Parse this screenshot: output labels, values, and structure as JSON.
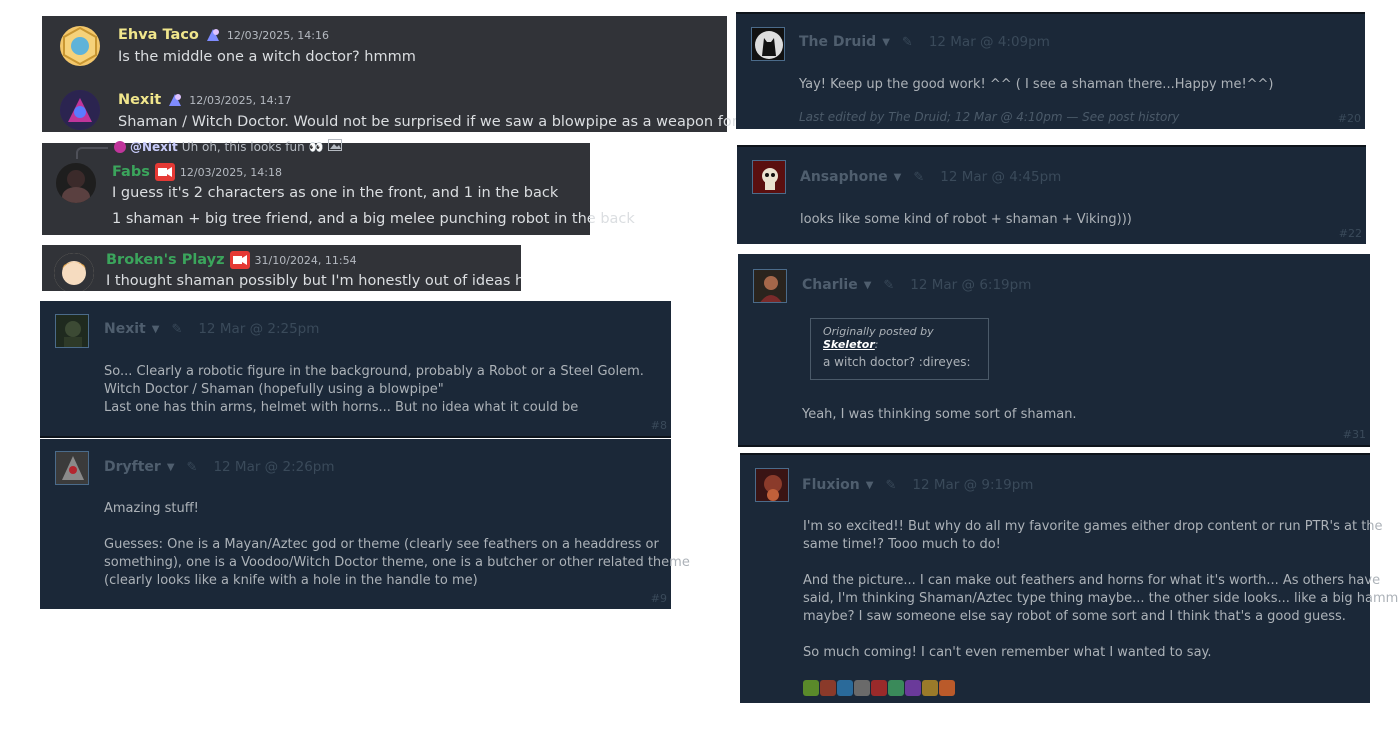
{
  "discord": {
    "panel1": {
      "messages": [
        {
          "name": "Ehva Taco",
          "name_color": "#f0e68c",
          "timestamp": "12/03/2025, 14:16",
          "text": "Is the middle one a witch doctor? hmmm"
        },
        {
          "name": "Nexit",
          "name_color": "#f0e68c",
          "timestamp": "12/03/2025, 14:17",
          "text": "Shaman / Witch Doctor. Would not be surprised if we saw a blowpipe as a weapon for him"
        }
      ]
    },
    "panel2": {
      "reply": {
        "mention": "@Nexit",
        "text": "Uh oh, this looks fun 👀"
      },
      "name": "Fabs",
      "name_color": "#3ba55c",
      "timestamp": "12/03/2025, 14:18",
      "lines": [
        "I guess it's 2 characters as one in the front, and 1 in the back",
        "1 shaman + big tree friend, and a big melee punching robot in the back"
      ]
    },
    "panel3": {
      "name": "Broken's Playz",
      "name_color": "#3ba55c",
      "timestamp": "31/10/2024, 11:54",
      "text": "I thought shaman possibly but I'm honestly out of ideas haha"
    }
  },
  "steam": {
    "nexit": {
      "name": "Nexit",
      "date": "12 Mar @ 2:25pm",
      "number": "#8",
      "lines": [
        "So... Clearly a robotic figure in the background, probably a Robot or a Steel Golem.",
        "Witch Doctor / Shaman (hopefully using a blowpipe\"",
        "Last one has thin arms, helmet with horns... But no idea what it could be"
      ]
    },
    "dryfter": {
      "name": "Dryfter",
      "date": "12 Mar @ 2:26pm",
      "number": "#9",
      "lines": [
        "Amazing stuff!",
        "",
        "Guesses: One is a Mayan/Aztec god or theme (clearly see feathers on a headdress or",
        "something), one is a Voodoo/Witch Doctor theme, one is a butcher or other related theme",
        "(clearly looks like a knife with a hole in the handle to me)"
      ]
    },
    "druid": {
      "name": "The Druid",
      "date": "12 Mar @ 4:09pm",
      "number": "#20",
      "text": "Yay! Keep up the good work! ^^ ( I see a shaman there...Happy me!^^)",
      "edit": "Last edited by The Druid; 12 Mar @ 4:10pm — See post history"
    },
    "ansaphone": {
      "name": "Ansaphone",
      "date": "12 Mar @ 4:45pm",
      "number": "#22",
      "text": "looks like some kind of robot + shaman + Viking)))"
    },
    "charlie": {
      "name": "Charlie",
      "date": "12 Mar @ 6:19pm",
      "number": "#31",
      "quote_prefix": "Originally posted by",
      "quote_author": "Skeletor",
      "quote_text": "a witch doctor? :direyes:",
      "text": "Yeah, I was thinking some sort of shaman."
    },
    "fluxion": {
      "name": "Fluxion",
      "date": "12 Mar @ 9:19pm",
      "lines": [
        "I'm so excited!! But why do all my favorite games either drop content or run PTR's at the",
        "same time!? Tooo much to do!",
        "",
        "And the picture... I can make out feathers and horns for what it's worth... As others have",
        "said, I'm thinking Shaman/Aztec type thing maybe... the other side looks... like a big hammer",
        "maybe? I saw someone else say robot of some sort and I think that's a good guess.",
        "",
        "So much coming! I can't even remember what I wanted to say."
      ]
    }
  },
  "colors": {
    "discord_bg": "#313338",
    "steam_bg": "#1b2838",
    "steam_text": "#acb2b8"
  }
}
